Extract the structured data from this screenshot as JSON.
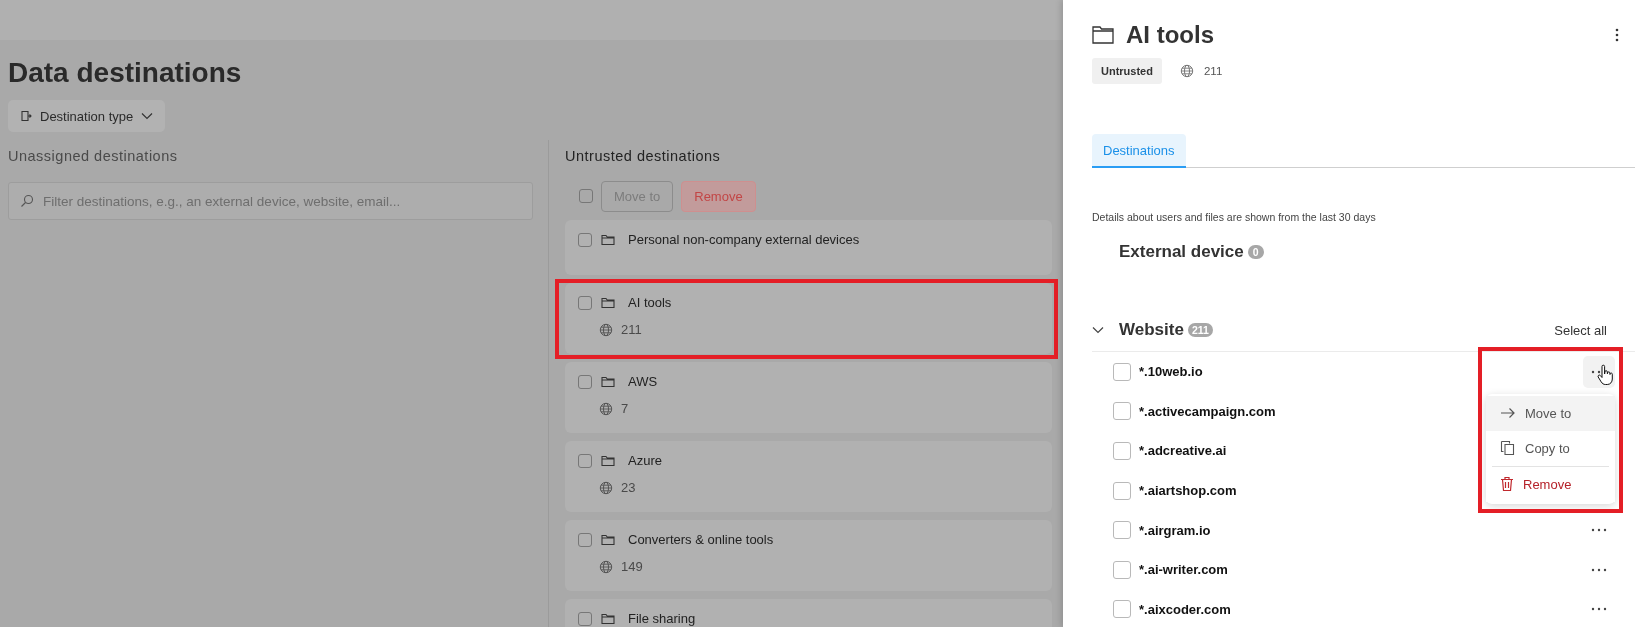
{
  "page": {
    "title": "Data destinations",
    "filter_button": "Destination type",
    "unassigned": {
      "heading": "Unassigned destinations",
      "search": {
        "placeholder": "Filter destinations, e.g., an external device, website, email..."
      }
    },
    "untrusted": {
      "heading": "Untrusted destinations",
      "all_checked": false,
      "actions": [
        {
          "label": "Move to",
          "kind": "neutral",
          "disabled": true
        },
        {
          "label": "Remove",
          "kind": "danger",
          "disabled": true
        }
      ],
      "groups": [
        {
          "name": "Personal non-company external devices",
          "checked": false,
          "highlighted": false
        },
        {
          "name": "AI tools",
          "count": "211",
          "checked": false,
          "highlighted": true
        },
        {
          "name": "AWS",
          "count": "7",
          "checked": false,
          "highlighted": false
        },
        {
          "name": "Azure",
          "count": "23",
          "checked": false,
          "highlighted": false
        },
        {
          "name": "Converters & online tools",
          "count": "149",
          "checked": false,
          "highlighted": false
        },
        {
          "name": "File sharing",
          "checked": false,
          "highlighted": false
        }
      ]
    }
  },
  "panel": {
    "title": "AI tools",
    "status_badge": "Untrusted",
    "count": "211",
    "tabs": [
      {
        "label": "Destinations",
        "selected": true
      }
    ],
    "note": "Details about users and files are shown from the last 30 days",
    "sections": [
      {
        "title": "External device",
        "count": "0",
        "collapsible": false
      },
      {
        "title": "Website",
        "count": "211",
        "collapsible": true,
        "expanded": true,
        "select_all": "Select all",
        "items": [
          {
            "name": "*.10web.io",
            "checked": false,
            "hovered": true
          },
          {
            "name": "*.activecampaign.com",
            "checked": false,
            "hovered": false
          },
          {
            "name": "*.adcreative.ai",
            "checked": false,
            "hovered": false
          },
          {
            "name": "*.aiartshop.com",
            "checked": false,
            "hovered": false
          },
          {
            "name": "*.airgram.io",
            "checked": false,
            "hovered": false
          },
          {
            "name": "*.ai-writer.com",
            "checked": false,
            "hovered": false
          },
          {
            "name": "*.aixcoder.com",
            "checked": false,
            "hovered": false
          }
        ]
      }
    ],
    "menu": {
      "highlighted": true,
      "items": [
        {
          "label": "Move to",
          "kind": "move",
          "selected": true
        },
        {
          "label": "Copy to",
          "kind": "copy",
          "selected": false
        },
        {
          "label": "Remove",
          "kind": "remove",
          "selected": false
        }
      ]
    }
  }
}
